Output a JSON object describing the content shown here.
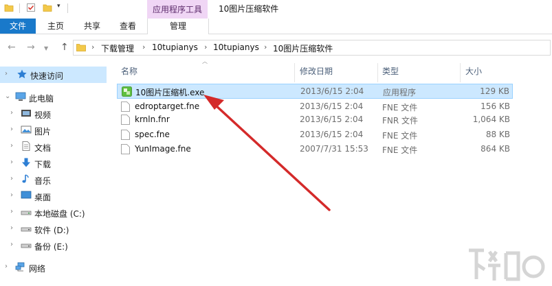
{
  "window": {
    "title": "10图片压缩软件"
  },
  "ribbon": {
    "context_group": "应用程序工具",
    "tabs": {
      "file": "文件",
      "home": "主页",
      "share": "共享",
      "view": "查看",
      "manage": "管理"
    }
  },
  "address": {
    "crumbs": [
      "下载管理",
      "10tupianys",
      "10tupianys",
      "10图片压缩软件"
    ]
  },
  "nav": {
    "items": [
      {
        "label": "快速访问",
        "icon": "star-icon"
      },
      {
        "label": "此电脑",
        "icon": "computer-icon"
      },
      {
        "label": "视频",
        "icon": "video-icon"
      },
      {
        "label": "图片",
        "icon": "picture-icon"
      },
      {
        "label": "文档",
        "icon": "document-icon"
      },
      {
        "label": "下载",
        "icon": "download-icon"
      },
      {
        "label": "音乐",
        "icon": "music-icon"
      },
      {
        "label": "桌面",
        "icon": "desktop-icon"
      },
      {
        "label": "本地磁盘 (C:)",
        "icon": "drive-icon"
      },
      {
        "label": "软件 (D:)",
        "icon": "drive-icon"
      },
      {
        "label": "备份 (E:)",
        "icon": "drive-icon"
      },
      {
        "label": "网络",
        "icon": "network-icon"
      }
    ]
  },
  "list": {
    "columns": {
      "name": "名称",
      "date": "修改日期",
      "type": "类型",
      "size": "大小"
    },
    "rows": [
      {
        "name": "10图片压缩机.exe",
        "date": "2013/6/15 2:04",
        "type": "应用程序",
        "size": "129 KB",
        "icon": "exe-icon"
      },
      {
        "name": "edroptarget.fne",
        "date": "2013/6/15 2:04",
        "type": "FNE 文件",
        "size": "156 KB",
        "icon": "file-icon"
      },
      {
        "name": "krnln.fnr",
        "date": "2013/6/15 2:04",
        "type": "FNR 文件",
        "size": "1,064 KB",
        "icon": "file-icon"
      },
      {
        "name": "spec.fne",
        "date": "2013/6/15 2:04",
        "type": "FNE 文件",
        "size": "88 KB",
        "icon": "file-icon"
      },
      {
        "name": "YunImage.fne",
        "date": "2007/7/31 15:53",
        "type": "FNE 文件",
        "size": "864 KB",
        "icon": "file-icon"
      }
    ]
  },
  "colors": {
    "accent": "#1979ca",
    "selection": "#cce8ff",
    "arrow": "#d42a2a",
    "context_tab": "#f0d6f5"
  }
}
